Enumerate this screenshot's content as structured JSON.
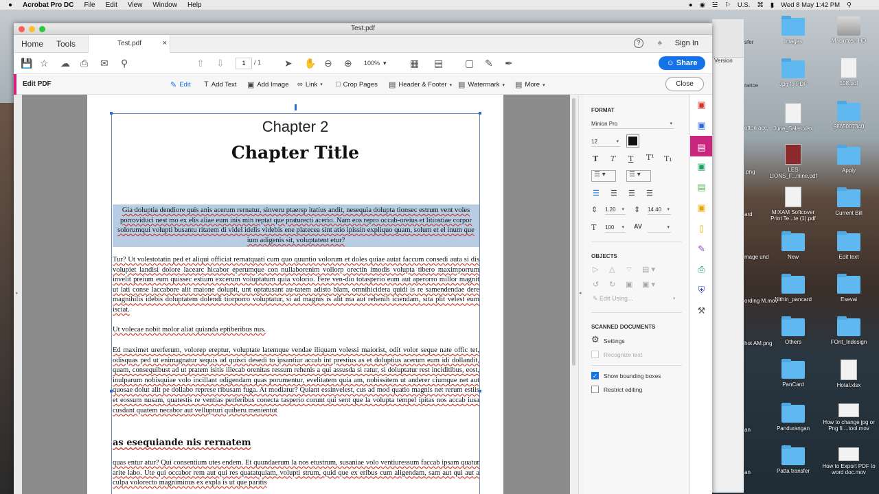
{
  "menubar": {
    "apple": "",
    "app": "Acrobat Pro DC",
    "items": [
      "File",
      "Edit",
      "View",
      "Window",
      "Help"
    ],
    "lang": "U.S.",
    "clock": "Wed 8 May  1:42 PM"
  },
  "window": {
    "title": "Test.pdf",
    "tabs": {
      "home": "Home",
      "tools": "Tools",
      "file": "Test.pdf",
      "close": "×"
    },
    "help": "?",
    "signin": "Sign In"
  },
  "toolbar": {
    "page_current": "1",
    "page_total": "/ 1",
    "zoom": "100%",
    "share": "Share"
  },
  "editbar": {
    "title": "Edit PDF",
    "edit": "Edit",
    "add_text": "Add Text",
    "add_image": "Add Image",
    "link": "Link",
    "crop": "Crop Pages",
    "header_footer": "Header & Footer",
    "watermark": "Watermark",
    "more": "More",
    "close": "Close"
  },
  "document": {
    "chapter_number": "Chapter 2",
    "chapter_title": "Chapter Title",
    "selected_paragraph": "Gia doluptia dendiore quis anis acerum rernatur, sinveru ptaersp itatius andit, nesequia dolupta tionsec estrum vent voles porroviduci nest mo ex elis aliae eum inis min reptat que praturecti acerio. Nam eos repro occab-oreius et litiostiae corpor solorumqui volupti busantu ritatem di videl idelis videbis ene platecea sint atio ipissin expliquo quam, solum et el inum que ium adigenis sit, voluptatent etur?",
    "para2": "Tur? Ut volestotatin ped et aliqui officiat rernatquati cum quo quuntio volorum et doles quiae autat faccum consedi auta si dis volupiet landisi dolore lacearc hicabor eperumque con nullaborenim vollorp orectin imodis volupta tibero maximporrum invelit preium eum quissec estium excerum voluptatum quia volorio. Fere ven-dio totasperio eum aut aperorro millor magnit ut lati conse laccabore alit maione dolupit, unt optatusant au-tatem adisto blam, omnihicidera quidi is re samendendae dere magnihilis idebis doluptatem dolendi tiorporro voluptatur, si ad magnis is alit ma aut rehenih iciendam, sita plit velest eum isciat.",
    "para2b": "Ut volecae nobit molor aliat quianda eptiberibus nus.",
    "para3": "Ed maximet urerferum, volorep ereptur, voluptate latemque vendae iliquam volessi maiorist, odit volor seque nate offic tet, odisquas ped ut enimagnatur sequis ad quisci desedi to ipsantiur accab int prestius as et doluptius acerum eum idi dollandit, quam, consequibust ad ut pratem isitis illecab orenitas ressum rehenis a qui assusda si ratur, si doluptatur rest inciditibus, eost, inulparum nobisquiae volo incillant odigendam quas porumentur, evelitatem quia am, nobissitem ut anderer ciumque net aut quosae dolut alit pe dollabo represe ribusam fuga. At modiatur? Quiant essinvelest, cus ad mod quatio magnis net rerum estiis et eossum nusam, quatestis re ventias perferibus conecta tasperio corunt qui sent que la volupta tempel ipitas nos accab iusa cusdant quatem necabor aut vellupturi quiberu menientot",
    "heading2": "as esequiande nis rernatem",
    "para4": "quas entur atur? Qui consentium utes endem. Et quundaerum la nos etustrum, susaniae volo ventiuressum faccab ipsam quatur arite labo. Ute qui occabor rem aut qui res quatatquiam, volupti strum, quid que ex eribus cum aligendam, sam aut qui aut a culpa volorecto magniminus ex expla is ut que paritis"
  },
  "format_panel": {
    "format_heading": "FORMAT",
    "font": "Minion Pro",
    "font_size": "12",
    "text_color": "#111111",
    "line_spacing": "1.20",
    "para_spacing": "14.40",
    "h_scale": "100",
    "objects_heading": "OBJECTS",
    "edit_using": "Edit Using...",
    "scanned_heading": "SCANNED DOCUMENTS",
    "settings": "Settings",
    "recognize": "Recognize text",
    "show_bboxes": "Show bounding boxes",
    "show_bboxes_checked": true,
    "restrict": "Restrict editing",
    "restrict_checked": false
  },
  "desktop_icons": [
    {
      "label": "Images",
      "type": "folder"
    },
    {
      "label": "Macintosh HD",
      "type": "drive"
    },
    {
      "label": "Jpg to PDF",
      "type": "folder"
    },
    {
      "label": "108.pdf",
      "type": "file"
    },
    {
      "label": "June_Sales.xlsx",
      "type": "file"
    },
    {
      "label": "9865007340",
      "type": "folder"
    },
    {
      "label": "LES LIONS_F...nline.pdf",
      "type": "file"
    },
    {
      "label": "Apply",
      "type": "folder"
    },
    {
      "label": "MIXAM Softcover Print Te...te (1).pdf",
      "type": "file"
    },
    {
      "label": "Current Bill",
      "type": "folder"
    },
    {
      "label": "New",
      "type": "folder"
    },
    {
      "label": "Edit text",
      "type": "folder"
    },
    {
      "label": "Nithin_pancard",
      "type": "folder"
    },
    {
      "label": "Esevai",
      "type": "folder"
    },
    {
      "label": "Others",
      "type": "folder"
    },
    {
      "label": "FOnt_Indesign",
      "type": "folder"
    },
    {
      "label": "PanCard",
      "type": "folder"
    },
    {
      "label": "Hotal.xlsx",
      "type": "file"
    },
    {
      "label": "Pandurangan",
      "type": "folder"
    },
    {
      "label": "How to change jpg or Png fi....tool.mov",
      "type": "file"
    },
    {
      "label": "Patta transfer",
      "type": "folder"
    },
    {
      "label": "How to Export PDF to word doc.mov",
      "type": "file"
    }
  ],
  "partial_labels": [
    "sfer",
    "Version",
    "rance",
    "otton ace",
    ".png",
    "ard",
    "mage und",
    "ording M.mov",
    "hot AM.png",
    "an",
    "an"
  ]
}
